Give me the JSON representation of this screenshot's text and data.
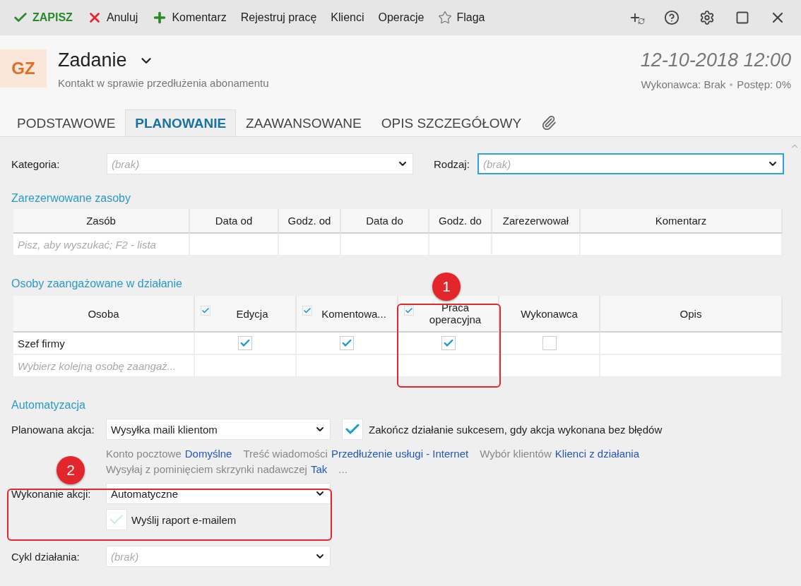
{
  "toolbar": {
    "actions": [
      {
        "kind": "save",
        "label": "ZAPISZ"
      },
      {
        "kind": "cancel",
        "label": "Anuluj"
      },
      {
        "kind": "add",
        "label": "Komentarz"
      },
      {
        "kind": "plain",
        "label": "Rejestruj pracę"
      },
      {
        "kind": "plain",
        "label": "Klienci"
      },
      {
        "kind": "plain",
        "label": "Operacje"
      },
      {
        "kind": "star",
        "label": "Flaga"
      }
    ]
  },
  "header": {
    "badge": "GZ",
    "title": "Zadanie",
    "subtitle": "Kontakt w sprawie przedłużenia abonamentu",
    "datetime": "12-10-2018 12:00",
    "meta": [
      "Wykonawca: Brak",
      "Postęp: 0%"
    ]
  },
  "tabs": [
    {
      "label": "PODSTAWOWE",
      "selected": false
    },
    {
      "label": "PLANOWANIE",
      "selected": true
    },
    {
      "label": "ZAAWANSOWANE",
      "selected": false
    },
    {
      "label": "OPIS SZCZEGÓŁOWY",
      "selected": false
    }
  ],
  "fields": [
    {
      "label": "Kategoria:",
      "placeholder": "(brak)",
      "focused": false
    },
    {
      "label": "Rodzaj:",
      "placeholder": "(brak)",
      "focused": true
    }
  ],
  "reserved": {
    "title": "Zarezerwowane zasoby",
    "columns": [
      "Zasób",
      "Data od",
      "Godz. od",
      "Data do",
      "Godz. do",
      "Zarezerwował",
      "Komentarz"
    ],
    "search_placeholder": "Pisz, aby wyszukać; F2 - lista"
  },
  "persons": {
    "title": "Osoby zaangażowane w działanie",
    "columns": [
      {
        "label": "Osoba",
        "kind": "text"
      },
      {
        "label": "Edycja",
        "kind": "check",
        "checked": true
      },
      {
        "label": "Komentowa...",
        "kind": "check",
        "checked": true
      },
      {
        "label": "Praca operacyjna",
        "kind": "check",
        "checked": true
      },
      {
        "label": "Wykonawca",
        "kind": "plain"
      },
      {
        "label": "Opis",
        "kind": "text"
      }
    ],
    "rows": [
      {
        "name": "Szef firmy",
        "checks": [
          true,
          true,
          true,
          false
        ]
      }
    ],
    "new_placeholder": "Wybierz kolejną osobę zaangaż..."
  },
  "automation": {
    "title": "Automatyzacja",
    "planned_action": {
      "label": "Planowana akcja:",
      "value": "Wysyłka maili klientom"
    },
    "finish_checkbox": {
      "label": "Zakończ działanie sukcesem, gdy akcja wykonana bez błędów",
      "checked": true
    },
    "details": [
      [
        {
          "label": "Konto pocztowe",
          "value": "Domyślne"
        },
        {
          "label": "Treść wiadomości",
          "value": "Przedłużenie usługi - Internet"
        },
        {
          "label": "Wybór klientów",
          "value": "Klienci z działania"
        }
      ],
      [
        {
          "label": "Wysyłaj z pominięciem skrzynki nadawczej",
          "value": "Tak"
        },
        {
          "label": "..."
        }
      ]
    ],
    "execution": {
      "label": "Wykonanie akcji:",
      "value": "Automatyczne"
    },
    "report_checkbox": {
      "label": "Wyślij raport e-mailem",
      "checked": false
    },
    "cycle": {
      "label": "Cykl działania:",
      "placeholder": "(brak)"
    }
  },
  "annotations": [
    {
      "number": "1"
    },
    {
      "number": "2"
    }
  ]
}
